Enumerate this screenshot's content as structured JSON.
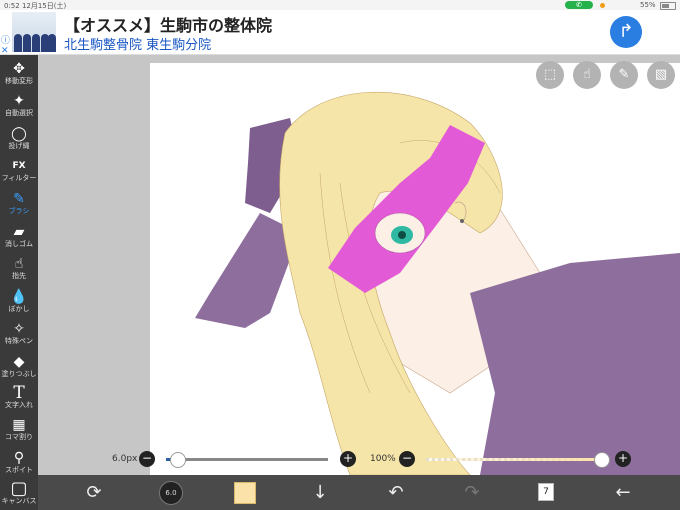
{
  "status_bar": {
    "time": "0:52 12月15日(土)",
    "battery": "55%"
  },
  "ad": {
    "info": "ⓘ\n✕",
    "title": "【オススメ】生駒市の整体院",
    "subtitle": "北生駒整骨院 東生駒分院",
    "go_icon": "↱"
  },
  "tools": [
    {
      "icon": "✥",
      "label": "移動変形"
    },
    {
      "icon": "✦",
      "label": "自動選択"
    },
    {
      "icon": "◯",
      "label": "投げ縄"
    },
    {
      "icon": "FX",
      "label": "フィルター"
    },
    {
      "icon": "✎",
      "label": "ブラシ"
    },
    {
      "icon": "▰",
      "label": "消しゴム"
    },
    {
      "icon": "☝",
      "label": "指先"
    },
    {
      "icon": "💧",
      "label": "ぼかし"
    },
    {
      "icon": "✧",
      "label": "特殊ペン"
    },
    {
      "icon": "◆",
      "label": "塗りつぶし"
    },
    {
      "icon": "T",
      "label": "文字入れ"
    },
    {
      "icon": "▦",
      "label": "コマ割り"
    },
    {
      "icon": "⚲",
      "label": "スポイト"
    },
    {
      "icon": "▢",
      "label": "キャンバス"
    }
  ],
  "active_tool": "ブラシ",
  "top_actions": [
    {
      "name": "selection-icon",
      "glyph": "⬚"
    },
    {
      "name": "hand-icon",
      "glyph": "☝"
    },
    {
      "name": "ruler-icon",
      "glyph": "✎"
    },
    {
      "name": "image-icon",
      "glyph": "▧"
    }
  ],
  "brush_size": {
    "label": "6.0px",
    "fraction": 0.07,
    "minus": "−",
    "plus": "+"
  },
  "opacity": {
    "label": "100%",
    "fraction": 1.0,
    "minus": "−",
    "plus": "+"
  },
  "bottom": {
    "transform": "⟳",
    "brush_preview_label": "6.0",
    "color": "#fbe2a8",
    "down": "↓",
    "undo": "↶",
    "redo": "↷",
    "layer_count": "7",
    "back": "←"
  }
}
